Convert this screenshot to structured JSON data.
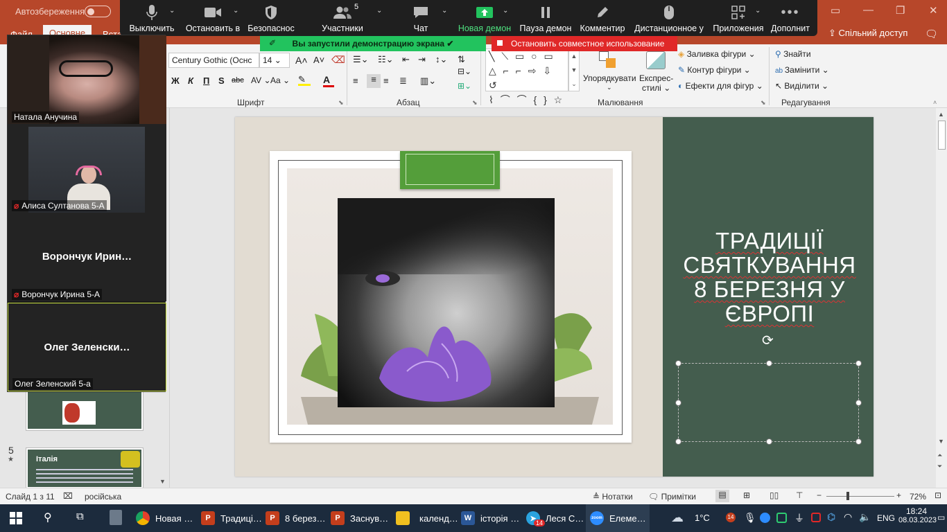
{
  "powerpoint": {
    "autosave_label": "Автозбереження",
    "tabs": [
      "Файл",
      "Основне",
      "Встав"
    ],
    "share_label": "Спільний доступ",
    "font_name": "Century Gothic (Оснс",
    "font_size": "14",
    "groups": {
      "font": "Шрифт",
      "paragraph": "Абзац",
      "drawing": "Малювання",
      "editing": "Редагування"
    },
    "drawing": {
      "arrange": "Упорядкувати",
      "quick_styles_1": "Експрес-",
      "quick_styles_2": "стилі",
      "fill": "Заливка фігури",
      "outline": "Контур фігури",
      "effects": "Ефекти для фігур"
    },
    "editing": {
      "find": "Знайти",
      "replace": "Замінити",
      "select": "Виділити"
    },
    "format_buttons": [
      "Ж",
      "К",
      "П",
      "S",
      "abc"
    ],
    "slide": {
      "title_lines": [
        "ТРАДИЦІЇ",
        "СВЯТКУВАННЯ",
        "8 БЕРЕЗНЯ У",
        "ЄВРОПІ"
      ],
      "colors": {
        "green_panel": "#445d4e",
        "tab_green": "#549e3a",
        "background": "#e2dcd2"
      }
    },
    "thumbnails": [
      {
        "number": "",
        "caption": ""
      },
      {
        "number": "5",
        "star": "★",
        "title": "Італія"
      }
    ],
    "status": {
      "slide_info": "Слайд 1 з 11",
      "language": "російська",
      "notes": "Нотатки",
      "comments": "Примітки",
      "zoom": "72%"
    }
  },
  "zoom": {
    "toolbar": [
      {
        "label": "Выключить",
        "icon": "microphone-icon"
      },
      {
        "label": "Остановить в",
        "icon": "video-camera-icon"
      },
      {
        "label": "Безопаснос",
        "icon": "shield-icon"
      },
      {
        "label": "Участники",
        "icon": "participants-icon",
        "count": "5"
      },
      {
        "label": "Чат",
        "icon": "chat-icon"
      },
      {
        "label": "Новая демон",
        "icon": "share-screen-icon"
      },
      {
        "label": "Пауза демон",
        "icon": "pause-icon"
      },
      {
        "label": "Комментир",
        "icon": "pencil-icon"
      },
      {
        "label": "Дистанционное у",
        "icon": "mouse-icon"
      },
      {
        "label": "Приложения",
        "icon": "apps-icon"
      },
      {
        "label": "Дополнит",
        "icon": "more-icon"
      }
    ],
    "share_banner": "Вы запустили демонстрацию экрана",
    "stop_banner": "Остановить совместное использование",
    "participants": [
      {
        "name": "Натала Анучина",
        "muted": false,
        "video": true
      },
      {
        "name": "Алиса Султанова 5-А",
        "muted": true,
        "video": true
      },
      {
        "name": "Ворончук Ирина 5-А",
        "display": "Ворончук  Ирин…",
        "muted": true,
        "video": false
      },
      {
        "name": "Олег Зеленский 5-а",
        "display": "Олег  Зеленски…",
        "muted": false,
        "video": false
      }
    ]
  },
  "taskbar": {
    "apps": [
      {
        "label": "Новая …",
        "icon": "chrome-icon",
        "color": "#e5402b"
      },
      {
        "label": "Традиці…",
        "icon": "powerpoint-icon",
        "color": "#c43e1c"
      },
      {
        "label": "8 берез…",
        "icon": "powerpoint-icon",
        "color": "#c43e1c"
      },
      {
        "label": "Заснув…",
        "icon": "powerpoint-icon",
        "color": "#c43e1c"
      },
      {
        "label": "календ…",
        "icon": "folder-icon",
        "color": "#f0c020"
      },
      {
        "label": "історія …",
        "icon": "word-icon",
        "color": "#2b5797"
      },
      {
        "label": "Леся С…",
        "icon": "telegram-icon",
        "color": "#2aa3df",
        "badge": "14"
      },
      {
        "label": "Елеме…",
        "icon": "zoom-icon",
        "color": "#2d8cff"
      }
    ],
    "weather": "1°C",
    "badge_14": "14",
    "language": "ENG",
    "time": "18:24",
    "date": "08.03.2023"
  }
}
